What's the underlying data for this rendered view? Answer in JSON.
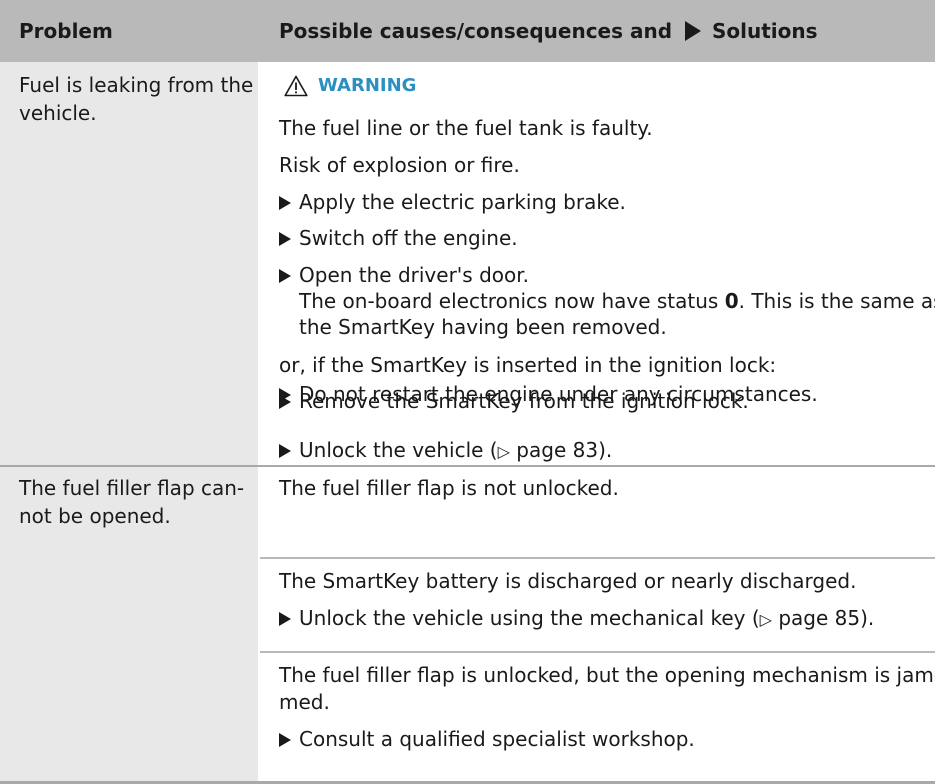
{
  "header": {
    "problem": "Problem",
    "solutions_prefix": "Possible causes/consequences and",
    "solutions_suffix": "Solutions"
  },
  "rows": [
    {
      "problem_lines": [
        "Fuel is leaking from the",
        "vehicle."
      ],
      "warning_label": "WARNING",
      "cause_1": "The fuel line or the fuel tank is faulty.",
      "cause_2": "Risk of explosion or fire.",
      "steps_a": [
        "Apply the electric parking brake.",
        "Switch off the engine.",
        "Open the driver's door."
      ],
      "status_note_prefix": "The on-board electronics now have status ",
      "status_value": "0",
      "status_note_suffix": ". This is the same as",
      "status_note_line2": "the SmartKey having been removed.",
      "alternative": "or, if the SmartKey is inserted in the ignition lock:",
      "steps_b": [
        "Remove the SmartKey from the ignition lock.",
        "Do not restart the engine under any circumstances.",
        "Consult a qualified specialist workshop."
      ]
    },
    {
      "problem_lines": [
        "The fuel filler flap can-",
        "not be opened."
      ],
      "block_1_cause": "The fuel filler flap is not unlocked.",
      "block_1_step_prefix": "Unlock the vehicle (",
      "block_1_page_ref": "page 83",
      "block_1_step_suffix": ").",
      "block_2_cause": "The SmartKey battery is discharged or nearly discharged.",
      "block_2_step_prefix": "Unlock the vehicle using the mechanical key (",
      "block_2_page_ref": "page 85",
      "block_2_step_suffix": ").",
      "block_3_cause_line1": "The fuel filler flap is unlocked, but the opening mechanism is jam-",
      "block_3_cause_line2": "med.",
      "block_3_step": "Consult a qualified specialist workshop."
    }
  ],
  "symbols": {
    "bullet": "filled-right-triangle",
    "page_ref": "▷",
    "warning_icon": "warning-triangle-icon",
    "warning_color": "#2a8fc1",
    "header_bg": "#b9b9b9",
    "problem_col_bg": "#e8e8e8"
  }
}
